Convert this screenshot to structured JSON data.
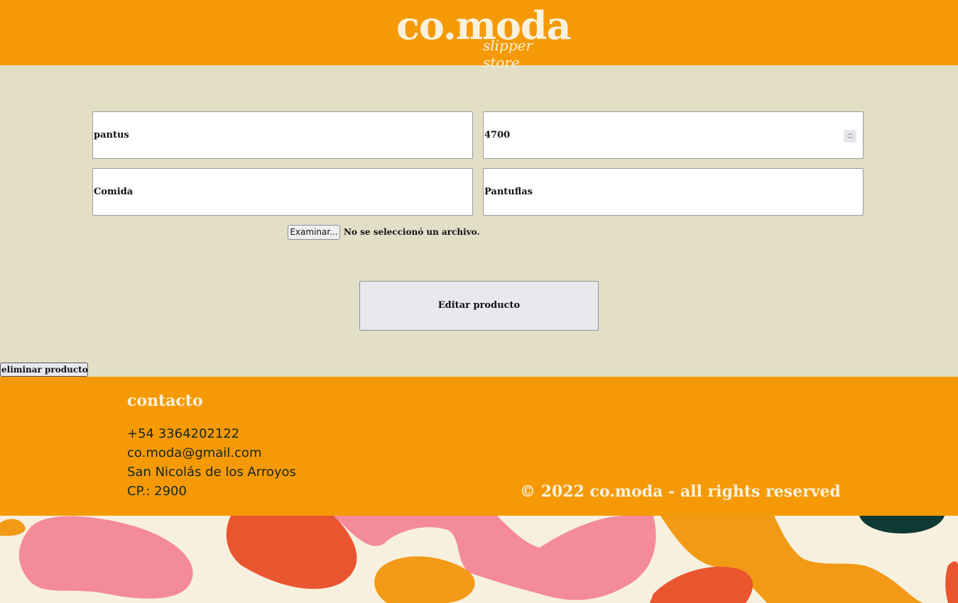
{
  "header": {
    "logo_main": "co.moda",
    "logo_sub": "slipper store"
  },
  "form": {
    "name_value": "pantus",
    "price_value": "4700",
    "category_value": "Comida",
    "type_value": "Pantuflas",
    "file_button_label": "Examinar...",
    "file_status": "No se seleccionó un archivo.",
    "submit_label": "Editar producto"
  },
  "delete_label": "eliminar producto",
  "footer": {
    "contact_title": "contacto",
    "phone": "+54 3364202122",
    "email": "co.moda@gmail.com",
    "city": "San Nicolás de los Arroyos",
    "postal_code": "CP.: 2900",
    "copyright": "© 2022 co.moda - all rights reserved"
  },
  "colors": {
    "brand_orange": "#f59a06",
    "page_background": "#e3dfc7",
    "cream": "#f9f1dc",
    "pattern_pink": "#f48b98",
    "pattern_red": "#e9552f",
    "pattern_orange": "#f29a16",
    "pattern_dark": "#0f3a33"
  }
}
